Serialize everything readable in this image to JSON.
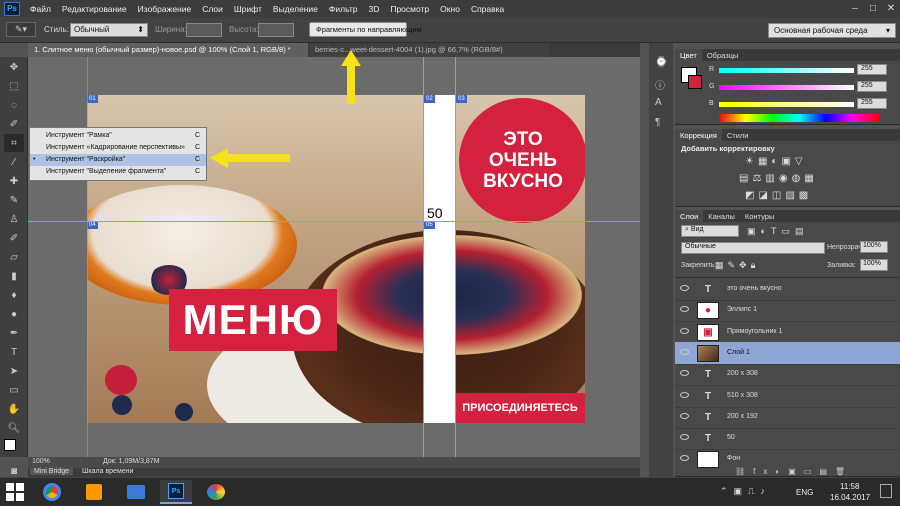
{
  "app": {
    "logo": "Ps"
  },
  "menu": [
    "Файл",
    "Редактирование",
    "Изображение",
    "Слои",
    "Шрифт",
    "Выделение",
    "Фильтр",
    "3D",
    "Просмотр",
    "Окно",
    "Справка"
  ],
  "options": {
    "style_label": "Стиль:",
    "style_value": "Обычный",
    "width_label": "Ширина:",
    "height_label": "Высота:",
    "slices_button": "Фрагменты по направляющим",
    "workspace": "Основная рабочая среда"
  },
  "tabs": [
    {
      "label": "1. Слитное меню (обычный размер)-новое.psd @ 100% (Слой 1, RGB/8) *",
      "active": true
    },
    {
      "label": "berries-c...weet-dessert-4004 (1).jpg @ 66,7% (RGB/8#)",
      "active": false
    }
  ],
  "flyout": {
    "items": [
      {
        "label": "Инструмент \"Рамка\"",
        "shortcut": "C",
        "selected": false
      },
      {
        "label": "Инструмент «Кадрирование перспективы»",
        "shortcut": "C",
        "selected": false
      },
      {
        "label": "Инструмент \"Раскройка\"",
        "shortcut": "C",
        "selected": true
      },
      {
        "label": "Инструмент \"Выделение фрагмента\"",
        "shortcut": "C",
        "selected": false
      }
    ]
  },
  "document": {
    "circle_text": [
      "ЭТО",
      "ОЧЕНЬ",
      "ВКУСНО"
    ],
    "menu_text": "МЕНЮ",
    "join_text": "ПРИСОЕДИНЯЕТЕСЬ",
    "fifty": "50",
    "slices": [
      "01",
      "02",
      "03",
      "04",
      "05"
    ]
  },
  "status": {
    "zoom": "100%",
    "doc": "Док: 1,09M/3,87M"
  },
  "bottom_tabs": [
    "Mini Bridge",
    "Шкала времени"
  ],
  "color_panel": {
    "tabs": [
      "Цвет",
      "Образцы"
    ],
    "channels": [
      {
        "name": "R",
        "value": "255"
      },
      {
        "name": "G",
        "value": "255"
      },
      {
        "name": "B",
        "value": "255"
      }
    ]
  },
  "adjust_panel": {
    "tabs": [
      "Коррекция",
      "Стили"
    ],
    "title": "Добавить корректировку"
  },
  "layers_panel": {
    "tabs": [
      "Слои",
      "Каналы",
      "Контуры"
    ],
    "kind": "Вид",
    "blend": "Обычные",
    "opacity_label": "Непрозрачность:",
    "opacity": "100%",
    "lock_label": "Закрепить:",
    "fill_label": "Заливка:",
    "fill": "100%",
    "layers": [
      {
        "name": "это очень вкусно",
        "type": "text"
      },
      {
        "name": "Эллипс 1",
        "type": "ellipse"
      },
      {
        "name": "Прямоугольник 1",
        "type": "rect"
      },
      {
        "name": "Слой 1",
        "type": "image",
        "selected": true
      },
      {
        "name": "200 x 308",
        "type": "text"
      },
      {
        "name": "510 x 308",
        "type": "text"
      },
      {
        "name": "200 x 192",
        "type": "text"
      },
      {
        "name": "50",
        "type": "text"
      },
      {
        "name": "Фон",
        "type": "bg"
      }
    ]
  },
  "taskbar": {
    "lang": "ENG",
    "time": "11:58",
    "date": "16.04.2017"
  },
  "colors": {
    "accent_red": "#d3213f",
    "guide": "#32c8e0",
    "arrow": "#f5e21a"
  }
}
